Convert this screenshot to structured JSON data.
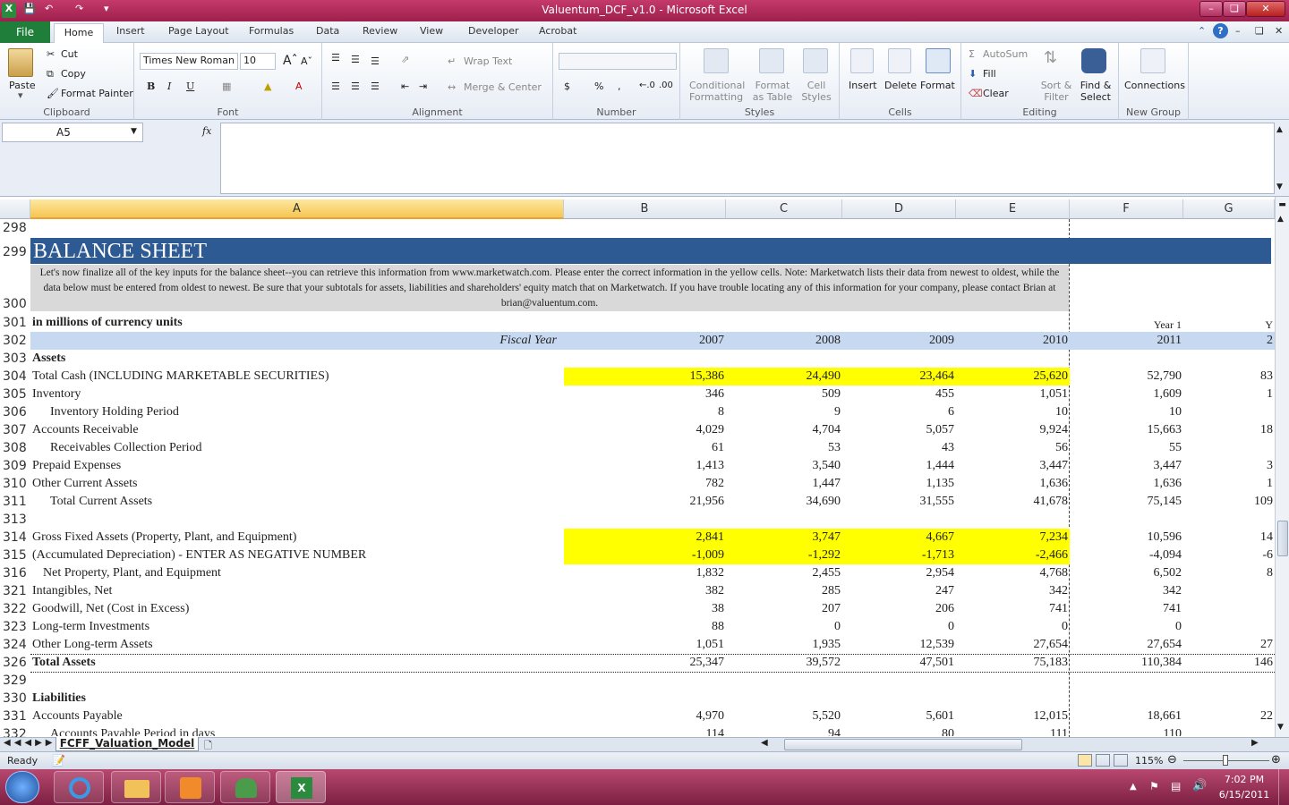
{
  "window": {
    "title": "Valuentum_DCF_v1.0  -  Microsoft Excel"
  },
  "ribbon": {
    "tabs": [
      "File",
      "Home",
      "Insert",
      "Page Layout",
      "Formulas",
      "Data",
      "Review",
      "View",
      "Developer",
      "Acrobat"
    ],
    "clipboard": {
      "paste": "Paste",
      "cut": "Cut",
      "copy": "Copy",
      "format_painter": "Format Painter",
      "label": "Clipboard"
    },
    "font": {
      "name": "Times New Roman",
      "size": "10",
      "label": "Font",
      "bold": "B",
      "italic": "I",
      "underline": "U"
    },
    "alignment": {
      "wrap_text": "Wrap Text",
      "merge_center": "Merge & Center",
      "label": "Alignment"
    },
    "number": {
      "currency": "$",
      "percent": "%",
      "comma": ",",
      "label": "Number"
    },
    "styles": {
      "conditional": "Conditional Formatting",
      "format_table": "Format as Table",
      "cell_styles": "Cell Styles",
      "label": "Styles"
    },
    "cells": {
      "insert": "Insert",
      "delete": "Delete",
      "format": "Format",
      "label": "Cells"
    },
    "editing": {
      "autosum": "AutoSum",
      "fill": "Fill",
      "clear": "Clear",
      "sort_filter": "Sort & Filter",
      "find_select": "Find & Select",
      "label": "Editing"
    },
    "newgroup": {
      "connections": "Connections",
      "label": "New Group"
    }
  },
  "formula_bar": {
    "name_box": "A5",
    "fx": "fx",
    "formula": ""
  },
  "columns": [
    "A",
    "B",
    "C",
    "D",
    "E",
    "F",
    "G"
  ],
  "header_title": "BALANCE SHEET",
  "note": "Let's now finalize all of the key inputs for the balance sheet--you can retrieve this information from www.marketwatch.com. Please enter the correct information in the yellow cells. Note: Marketwatch lists their data from newest to oldest, while the data below must be entered from oldest to newest. Be sure that your subtotals for assets, liabilities and shareholders' equity match that on Marketwatch. If you have trouble locating any of this information for your company, please contact Brian at brian@valuentum.com.",
  "units_label": "in millions of currency units",
  "year1_label": "Year 1",
  "year2_label_partial": "Y",
  "fiscal_year_label": "Fiscal Year",
  "years": [
    "2007",
    "2008",
    "2009",
    "2010",
    "2011",
    "2"
  ],
  "rows": [
    {
      "n": "303",
      "label": "Assets",
      "bold": true,
      "vals": [
        "",
        "",
        "",
        "",
        "",
        ""
      ]
    },
    {
      "n": "304",
      "label": "Total Cash (INCLUDING MARKETABLE SECURITIES)",
      "yellow": true,
      "vals": [
        "15,386",
        "24,490",
        "23,464",
        "25,620",
        "52,790",
        "83"
      ]
    },
    {
      "n": "305",
      "label": "Inventory",
      "vals": [
        "346",
        "509",
        "455",
        "1,051",
        "1,609",
        "1"
      ]
    },
    {
      "n": "306",
      "label": "Inventory Holding Period",
      "indent": 20,
      "vals": [
        "8",
        "9",
        "6",
        "10",
        "10",
        ""
      ]
    },
    {
      "n": "307",
      "label": "Accounts Receivable",
      "vals": [
        "4,029",
        "4,704",
        "5,057",
        "9,924",
        "15,663",
        "18"
      ]
    },
    {
      "n": "308",
      "label": "Receivables Collection Period",
      "indent": 20,
      "vals": [
        "61",
        "53",
        "43",
        "56",
        "55",
        ""
      ]
    },
    {
      "n": "309",
      "label": "Prepaid Expenses",
      "vals": [
        "1,413",
        "3,540",
        "1,444",
        "3,447",
        "3,447",
        "3"
      ]
    },
    {
      "n": "310",
      "label": "Other Current Assets",
      "vals": [
        "782",
        "1,447",
        "1,135",
        "1,636",
        "1,636",
        "1"
      ]
    },
    {
      "n": "311",
      "label": "Total Current Assets",
      "indent": 20,
      "vals": [
        "21,956",
        "34,690",
        "31,555",
        "41,678",
        "75,145",
        "109"
      ]
    },
    {
      "n": "313",
      "label": "",
      "vals": [
        "",
        "",
        "",
        "",
        "",
        ""
      ]
    },
    {
      "n": "314",
      "label": "Gross Fixed Assets (Property, Plant, and Equipment)",
      "yellow": true,
      "vals": [
        "2,841",
        "3,747",
        "4,667",
        "7,234",
        "10,596",
        "14"
      ]
    },
    {
      "n": "315",
      "label": "(Accumulated Depreciation) - ENTER AS NEGATIVE NUMBER",
      "yellow": true,
      "vals": [
        "-1,009",
        "-1,292",
        "-1,713",
        "-2,466",
        "-4,094",
        "-6"
      ]
    },
    {
      "n": "316",
      "label": "Net Property, Plant, and Equipment",
      "indent": 12,
      "vals": [
        "1,832",
        "2,455",
        "2,954",
        "4,768",
        "6,502",
        "8"
      ]
    },
    {
      "n": "321",
      "label": "Intangibles, Net",
      "vals": [
        "382",
        "285",
        "247",
        "342",
        "342",
        ""
      ]
    },
    {
      "n": "322",
      "label": "Goodwill, Net (Cost in Excess)",
      "vals": [
        "38",
        "207",
        "206",
        "741",
        "741",
        ""
      ]
    },
    {
      "n": "323",
      "label": "Long-term Investments",
      "vals": [
        "88",
        "0",
        "0",
        "0",
        "0",
        ""
      ]
    },
    {
      "n": "324",
      "label": "Other Long-term Assets",
      "vals": [
        "1,051",
        "1,935",
        "12,539",
        "27,654",
        "27,654",
        "27"
      ]
    },
    {
      "n": "326",
      "label": "Total Assets",
      "bold": true,
      "vals": [
        "25,347",
        "39,572",
        "47,501",
        "75,183",
        "110,384",
        "146"
      ]
    },
    {
      "n": "329",
      "label": "",
      "vals": [
        "",
        "",
        "",
        "",
        "",
        ""
      ]
    },
    {
      "n": "330",
      "label": "Liabilities",
      "bold": true,
      "vals": [
        "",
        "",
        "",
        "",
        "",
        ""
      ]
    },
    {
      "n": "331",
      "label": "Accounts Payable",
      "vals": [
        "4,970",
        "5,520",
        "5,601",
        "12,015",
        "18,661",
        "22"
      ]
    },
    {
      "n": "332",
      "label": "Accounts Payable Period in days",
      "indent": 20,
      "vals": [
        "114",
        "94",
        "80",
        "111",
        "110",
        ""
      ]
    }
  ],
  "row_numbers_top": [
    "298",
    "299",
    "300",
    "301",
    "302"
  ],
  "sheet_tab": "FCFF_Valuation_Model",
  "status": {
    "ready": "Ready",
    "zoom": "115%"
  },
  "taskbar": {
    "time": "7:02 PM",
    "date": "6/15/2011"
  },
  "colors": {
    "title_bar": "#b02f5c",
    "section_bar": "#2e5a93",
    "year_row": "#c6d9f1",
    "input_yellow": "#ffff00",
    "note_bg": "#d9d9d9"
  }
}
